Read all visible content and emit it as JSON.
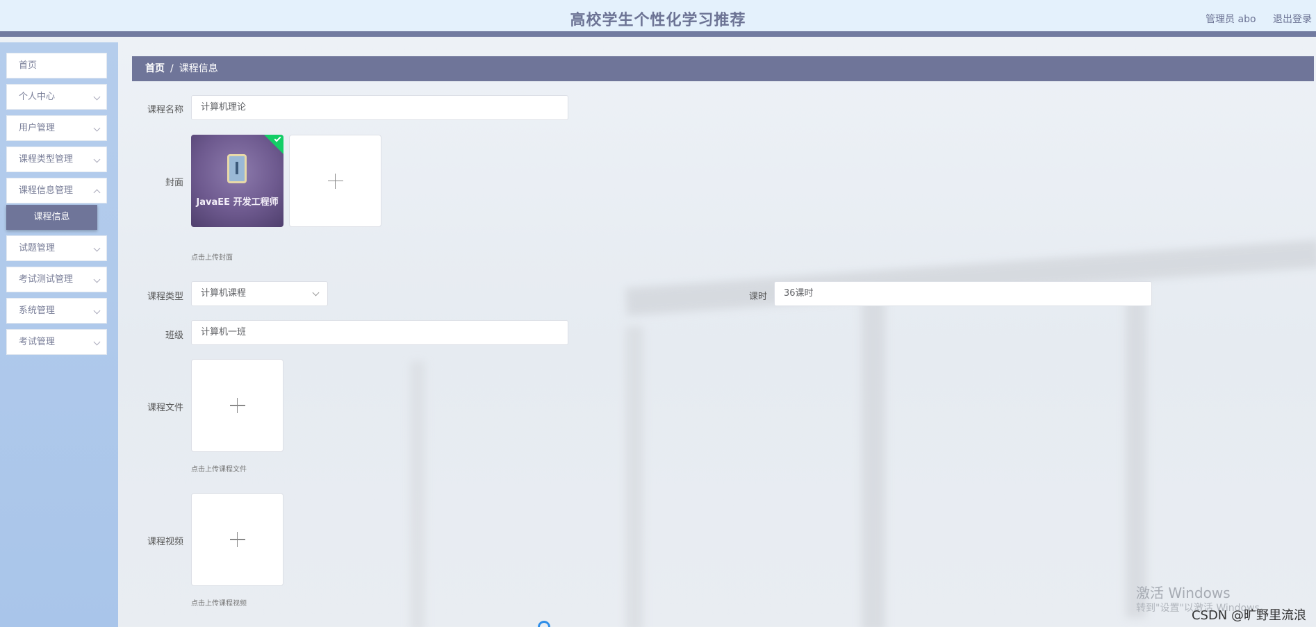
{
  "header": {
    "title": "高校学生个性化学习推荐",
    "user_label": "管理员 abo",
    "logout_label": "退出登录"
  },
  "sidebar": {
    "items": [
      {
        "label": "首页"
      },
      {
        "label": "个人中心"
      },
      {
        "label": "用户管理"
      },
      {
        "label": "课程类型管理"
      },
      {
        "label": "课程信息管理"
      },
      {
        "label": "试题管理"
      },
      {
        "label": "考试测试管理"
      },
      {
        "label": "系统管理"
      },
      {
        "label": "考试管理"
      }
    ],
    "active_sub": "课程信息"
  },
  "breadcrumb": {
    "home": "首页",
    "separator": "/",
    "current": "课程信息"
  },
  "form": {
    "course_name_label": "课程名称",
    "course_name_value": "计算机理论",
    "cover_label": "封面",
    "cover_image_text": "JavaEE 开发工程师",
    "cover_hint": "点击上传封面",
    "course_type_label": "课程类型",
    "course_type_value": "计算机课程",
    "hours_label": "课时",
    "hours_value": "36课时",
    "class_label": "班级",
    "class_value": "计算机一班",
    "file_label": "课程文件",
    "file_hint": "点击上传课程文件",
    "video_label": "课程视频",
    "video_hint": "点击上传课程视频"
  },
  "overlay": {
    "activate_windows": "激活 Windows",
    "activate_windows_sub": "转到\"设置\"以激活 Windows。",
    "csdn_watermark": "CSDN @旷野里流浪"
  },
  "colors": {
    "accent": "#6f7599",
    "header_bg": "#e4f1fc",
    "sidebar_bg": "#b0caec",
    "success": "#13ce66"
  }
}
